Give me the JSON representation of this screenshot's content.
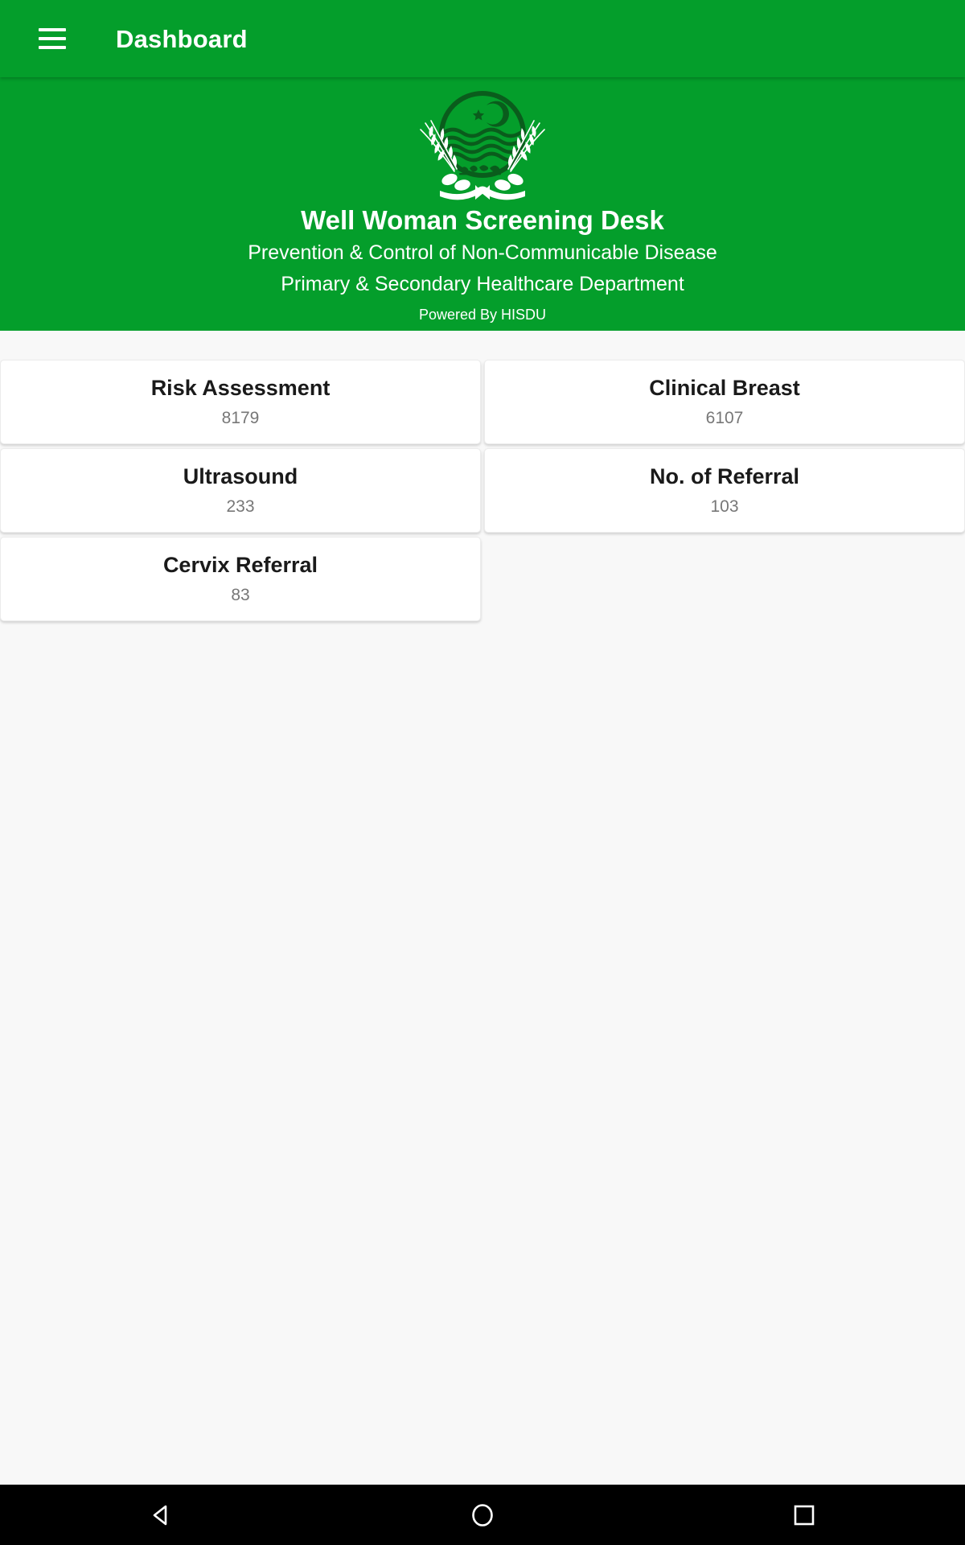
{
  "appbar": {
    "menu_icon": "hamburger-menu-icon",
    "title": "Dashboard"
  },
  "hero": {
    "crest_icon": "government-of-punjab-emblem",
    "title": "Well Woman Screening Desk",
    "subtitle_line1": "Prevention & Control of Non-Communicable Disease",
    "subtitle_line2": "Primary & Secondary Healthcare Department",
    "powered_by": "Powered By HISDU"
  },
  "stats": {
    "cards": [
      {
        "label": "Risk Assessment",
        "value": "8179"
      },
      {
        "label": "Clinical Breast",
        "value": "6107"
      },
      {
        "label": "Ultrasound",
        "value": "233"
      },
      {
        "label": "No. of Referral",
        "value": "103"
      },
      {
        "label": "Cervix Referral",
        "value": "83"
      }
    ]
  },
  "navbar": {
    "back": "back-triangle-icon",
    "home": "home-circle-icon",
    "recents": "recents-square-icon"
  },
  "colors": {
    "brand_green": "#049e2b",
    "page_background": "#f8f8f8",
    "card_background": "#ffffff",
    "card_label": "#1a1a1a",
    "card_value": "#777777",
    "navbar": "#000000"
  }
}
